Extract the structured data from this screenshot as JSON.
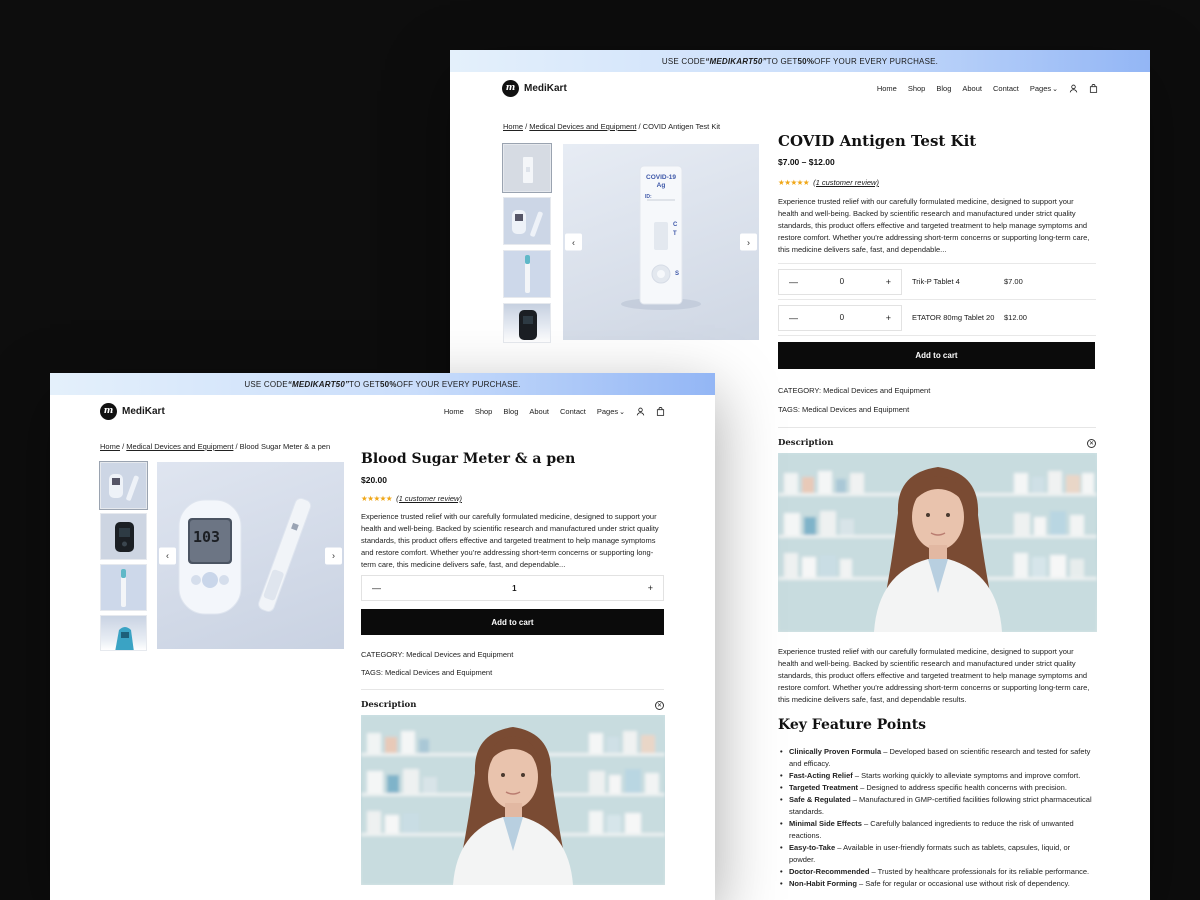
{
  "promo": {
    "prefix": "USE CODE ",
    "code": "“MEDIKART50”",
    "mid": " TO GET ",
    "pct": "50%",
    "suffix": " OFF YOUR EVERY PURCHASE."
  },
  "brand": {
    "name": "MediKart",
    "mark": "m"
  },
  "nav": {
    "items": [
      "Home",
      "Shop",
      "Blog",
      "About",
      "Contact",
      "Pages"
    ]
  },
  "back": {
    "breadcrumb": {
      "home": "Home",
      "category": "Medical Devices and Equipment",
      "current": " / COVID Antigen Test Kit"
    },
    "title": "COVID Antigen Test Kit",
    "price": "$7.00 – $12.00",
    "reviews": "(1 customer review)",
    "intro": "Experience trusted relief with our carefully formulated medicine, designed to support your health and well-being. Backed by scientific research and manufactured under strict quality standards, this product offers effective and targeted treatment to help manage symptoms and restore comfort. Whether you’re addressing short-term concerns or supporting long-term care, this medicine delivers safe, fast, and dependable...",
    "kit_label": "COVID-19\nAg",
    "kit_id": "ID:",
    "kit_c": "C",
    "kit_t": "T",
    "kit_s": "S",
    "variants": [
      {
        "qty": "0",
        "name": "Trik-P Tablet 4",
        "price": "$7.00"
      },
      {
        "qty": "0",
        "name": "ETATOR 80mg Tablet 20",
        "price": "$12.00"
      }
    ],
    "cart": "Add to cart",
    "category_label": "CATEGORY:",
    "category": " Medical Devices and Equipment",
    "tags_label": "TAGS:",
    "tags": " Medical Devices and Equipment",
    "desc_title": "Description",
    "desc_text": "Experience trusted relief with our carefully formulated medicine, designed to support your health and well-being. Backed by scientific research and manufactured under strict quality standards, this product offers effective and targeted treatment to help manage symptoms and restore comfort. Whether you’re addressing short-term concerns or supporting long-term care, this medicine delivers safe, fast, and dependable results.",
    "features_title": "Key Feature Points",
    "features": [
      {
        "b": "Clinically Proven Formula",
        "t": " – Developed based on scientific research and tested for safety and efficacy."
      },
      {
        "b": "Fast-Acting Relief",
        "t": " – Starts working quickly to alleviate symptoms and improve comfort."
      },
      {
        "b": "Targeted Treatment",
        "t": " – Designed to address specific health concerns with precision."
      },
      {
        "b": "Safe & Regulated",
        "t": " – Manufactured in GMP-certified facilities following strict pharmaceutical standards."
      },
      {
        "b": "Minimal Side Effects",
        "t": " – Carefully balanced ingredients to reduce the risk of unwanted reactions."
      },
      {
        "b": "Easy-to-Take",
        "t": " – Available in user-friendly formats such as tablets, capsules, liquid, or powder."
      },
      {
        "b": "Doctor-Recommended",
        "t": " – Trusted by healthcare professionals for its reliable performance."
      },
      {
        "b": "Non-Habit Forming",
        "t": " – Safe for regular or occasional use without risk of dependency."
      }
    ]
  },
  "front": {
    "breadcrumb": {
      "home": "Home",
      "category": "Medical Devices and Equipment",
      "current": " / Blood Sugar Meter & a pen"
    },
    "title": "Blood Sugar Meter & a pen",
    "price": "$20.00",
    "reviews": "(1 customer review)",
    "intro": "Experience trusted relief with our carefully formulated medicine, designed to support your health and well-being. Backed by scientific research and manufactured under strict quality standards, this product offers effective and targeted treatment to help manage symptoms and restore comfort. Whether you’re addressing short-term concerns or supporting long-term care, this medicine delivers safe, fast, and dependable...",
    "meter_reading": "103",
    "qty": "1",
    "cart": "Add to cart",
    "category_label": "CATEGORY:",
    "category": " Medical Devices and Equipment",
    "tags_label": "TAGS:",
    "tags": " Medical Devices and Equipment",
    "desc_title": "Description"
  },
  "colors": {
    "accent": "#0b0b0b",
    "stars": "#f0a718",
    "promo_end": "#93b6f5"
  },
  "icons": {
    "user": "user-icon",
    "bag": "bag-icon",
    "prev": "chevron-left-icon",
    "next": "chevron-right-icon",
    "minus": "minus-icon",
    "plus": "plus-icon",
    "close": "close-circle-icon"
  }
}
